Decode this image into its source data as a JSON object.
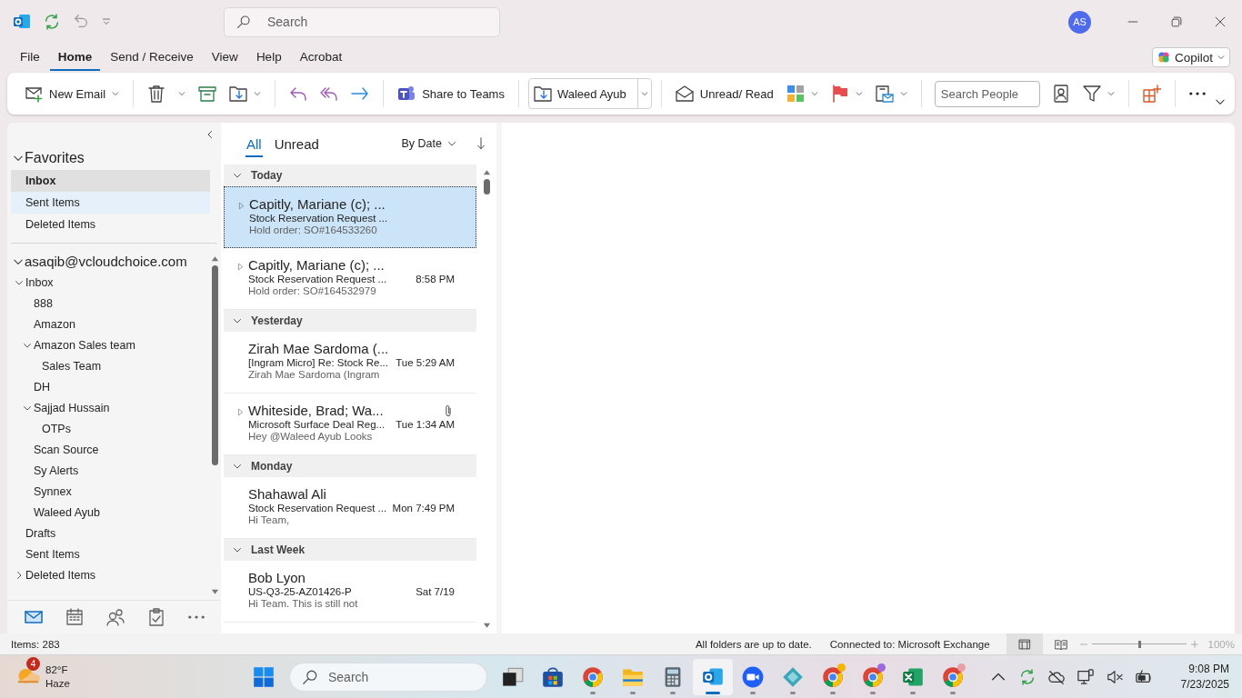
{
  "title_bar": {
    "search_placeholder": "Search",
    "avatar": "AS"
  },
  "menu_tabs": [
    {
      "label": "File",
      "selected": false
    },
    {
      "label": "Home",
      "selected": true
    },
    {
      "label": "Send / Receive",
      "selected": false
    },
    {
      "label": "View",
      "selected": false
    },
    {
      "label": "Help",
      "selected": false
    },
    {
      "label": "Acrobat",
      "selected": false
    }
  ],
  "copilot": "Copilot",
  "ribbon": [
    {
      "kind": "new_email",
      "label": "New Email"
    },
    {
      "kind": "separator"
    },
    {
      "kind": "delete"
    },
    {
      "kind": "archive"
    },
    {
      "kind": "move"
    },
    {
      "kind": "separator"
    },
    {
      "kind": "reply"
    },
    {
      "kind": "reply_all"
    },
    {
      "kind": "forward"
    },
    {
      "kind": "separator"
    },
    {
      "kind": "teams",
      "label": "Share to Teams"
    },
    {
      "kind": "separator"
    },
    {
      "kind": "quick_step",
      "label": "Waleed Ayub"
    },
    {
      "kind": "separator"
    },
    {
      "kind": "unread_read",
      "label": "Unread/ Read"
    },
    {
      "kind": "categorize"
    },
    {
      "kind": "flag"
    },
    {
      "kind": "rules"
    },
    {
      "kind": "separator"
    },
    {
      "kind": "search_people",
      "placeholder": "Search People"
    },
    {
      "kind": "address_book"
    },
    {
      "kind": "filter"
    },
    {
      "kind": "separator"
    },
    {
      "kind": "apps"
    },
    {
      "kind": "separator"
    },
    {
      "kind": "more"
    }
  ],
  "folders": {
    "favorites": {
      "label": "Favorites",
      "expanded": true,
      "items": [
        {
          "label": "Inbox",
          "selected": true,
          "highlighted": false
        },
        {
          "label": "Sent Items",
          "selected": false,
          "highlighted": true
        },
        {
          "label": "Deleted Items",
          "selected": false,
          "highlighted": false
        }
      ]
    },
    "account": {
      "label": "asaqib@vcloudchoice.com",
      "expanded": true,
      "children": [
        {
          "label": "Inbox",
          "expanded": true,
          "children": [
            {
              "label": "888"
            },
            {
              "label": "Amazon"
            },
            {
              "label": "Amazon Sales team",
              "expanded": true,
              "children": [
                {
                  "label": "Sales Team"
                }
              ]
            },
            {
              "label": "DH"
            },
            {
              "label": "Sajjad Hussain",
              "expanded": true,
              "children": [
                {
                  "label": "OTPs"
                }
              ]
            },
            {
              "label": "Scan Source"
            },
            {
              "label": "Sy Alerts"
            },
            {
              "label": "Synnex"
            },
            {
              "label": "Waleed Ayub"
            }
          ]
        },
        {
          "label": "Drafts"
        },
        {
          "label": "Sent Items"
        },
        {
          "label": "Deleted Items",
          "expanded": false
        }
      ]
    },
    "nav": [
      {
        "kind": "mail",
        "selected": true
      },
      {
        "kind": "calendar",
        "selected": false
      },
      {
        "kind": "people",
        "selected": false
      },
      {
        "kind": "tasks",
        "selected": false
      },
      {
        "kind": "more",
        "selected": false
      }
    ]
  },
  "message_list": {
    "filters": [
      {
        "label": "All",
        "selected": true
      },
      {
        "label": "Unread",
        "selected": false
      }
    ],
    "sort": "By Date",
    "groups": [
      {
        "label": "Today",
        "expanded": true,
        "messages": [
          {
            "sender": "Capitly, Mariane (c);  ...",
            "subject": "Stock Reservation Request ...",
            "preview": "Hold order: SO#164533260",
            "thread": true,
            "attachment": false,
            "selected": true
          },
          {
            "sender": "Capitly, Mariane (c);  ...",
            "subject": "Stock Reservation Request ...",
            "preview": "Hold order: SO#164532979",
            "time": "8:58 PM",
            "thread": true,
            "attachment": false,
            "selected": false
          }
        ]
      },
      {
        "label": "Yesterday",
        "expanded": true,
        "messages": [
          {
            "sender": "Zirah Mae Sardoma (...",
            "subject": "[Ingram Micro] Re: Stock Re...",
            "preview": "Zirah Mae Sardoma (Ingram",
            "time": "Tue 5:29 AM",
            "thread": false,
            "attachment": false,
            "selected": false
          },
          {
            "sender": "Whiteside, Brad;  Wa...",
            "subject": "Microsoft Surface Deal Reg...",
            "preview": "Hey @Waleed Ayub  Looks",
            "time": "Tue 1:34 AM",
            "thread": true,
            "attachment": true,
            "selected": false
          }
        ]
      },
      {
        "label": "Monday",
        "expanded": true,
        "messages": [
          {
            "sender": "Shahawal Ali",
            "subject": "Stock Reservation Request ...",
            "preview": "Hi Team,",
            "time": "Mon 7:49 PM",
            "thread": false,
            "attachment": false,
            "selected": false
          }
        ]
      },
      {
        "label": "Last Week",
        "expanded": true,
        "messages": [
          {
            "sender": "Bob Lyon",
            "subject": "US-Q3-25-AZ01426-P",
            "preview": "Hi Team.  This is still not",
            "time": "Sat 7/19",
            "thread": false,
            "attachment": false,
            "selected": false
          }
        ]
      }
    ]
  },
  "status_bar": {
    "items": "Items: 283",
    "sync": "All folders are up to date.",
    "connection": "Connected to: Microsoft Exchange",
    "views": [
      {
        "kind": "normal",
        "selected": true
      },
      {
        "kind": "reading",
        "selected": false
      }
    ],
    "zoom": {
      "level": 0.5,
      "reading": "100%"
    }
  },
  "taskbar": {
    "weather": {
      "badge": "4",
      "temperature": "82°F",
      "condition": "Haze"
    },
    "search_placeholder": "Search",
    "apps": [
      {
        "kind": "start",
        "running": false,
        "active": false
      },
      {
        "kind": "task_view",
        "running": false,
        "active": false
      },
      {
        "kind": "store",
        "running": false,
        "active": false
      },
      {
        "kind": "chrome",
        "running": true,
        "active": false
      },
      {
        "kind": "explorer",
        "running": true,
        "active": false
      },
      {
        "kind": "calculator",
        "running": true,
        "active": false
      },
      {
        "kind": "outlook",
        "running": true,
        "active": true
      },
      {
        "kind": "zoom",
        "running": true,
        "active": false
      },
      {
        "kind": "cube",
        "running": true,
        "active": false
      },
      {
        "kind": "chrome",
        "running": true,
        "active": false,
        "color": "#f4b400"
      },
      {
        "kind": "chrome",
        "running": true,
        "active": false,
        "color": "#9c6ade"
      },
      {
        "kind": "excel",
        "running": true,
        "active": false
      },
      {
        "kind": "chrome",
        "running": true,
        "active": false,
        "color": "#e8a0a8"
      }
    ],
    "tray": [
      {
        "kind": "overflow"
      },
      {
        "kind": "sync"
      },
      {
        "kind": "cloud_off"
      },
      {
        "kind": "network"
      },
      {
        "kind": "volume_muted"
      },
      {
        "kind": "battery"
      }
    ],
    "time": "9:08 PM",
    "date": "7/23/2025"
  }
}
